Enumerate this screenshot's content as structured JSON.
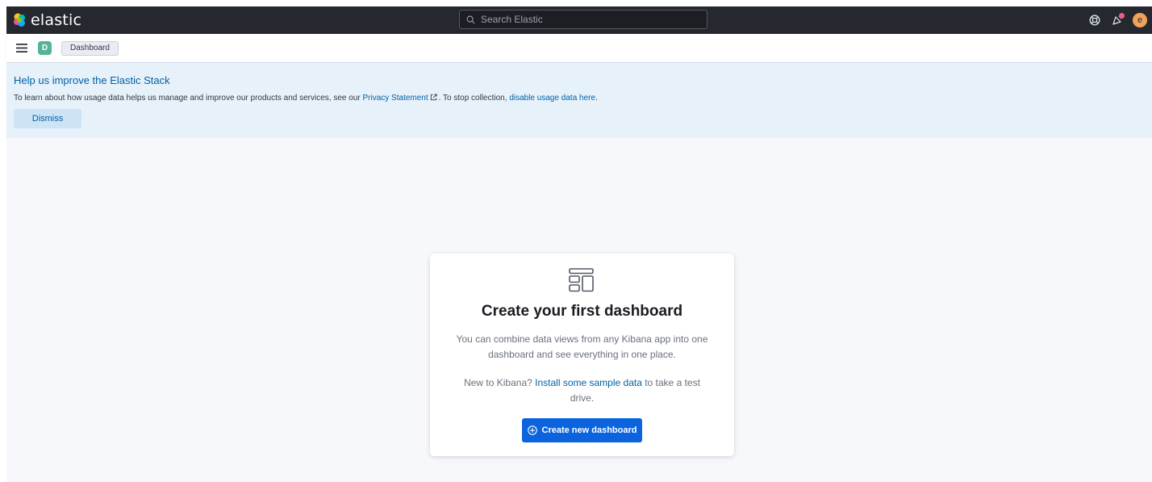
{
  "header": {
    "logo_text": "elastic",
    "search_placeholder": "Search Elastic",
    "avatar_initial": "e"
  },
  "subheader": {
    "space_initial": "D",
    "breadcrumb": "Dashboard"
  },
  "callout": {
    "title": "Help us improve the Elastic Stack",
    "body_prefix": "To learn about how usage data helps us manage and improve our products and services, see our ",
    "privacy_link": "Privacy Statement",
    "body_middle": ". To stop collection, ",
    "disable_link": "disable usage data here",
    "body_suffix": ".",
    "dismiss_label": "Dismiss"
  },
  "empty_state": {
    "icon": "dashboard-app-icon",
    "title": "Create your first dashboard",
    "description": "You can combine data views from any Kibana app into one dashboard and see everything in one place.",
    "sample_prefix": "New to Kibana? ",
    "sample_link": "Install some sample data",
    "sample_suffix": " to take a test drive.",
    "create_label": "Create new dashboard"
  },
  "colors": {
    "header_bg": "#25282f",
    "callout_bg": "#e6f1fa",
    "link": "#0061a6",
    "primary_button": "#0b64dd",
    "space_badge": "#54b399",
    "avatar": "#f4a25b"
  }
}
